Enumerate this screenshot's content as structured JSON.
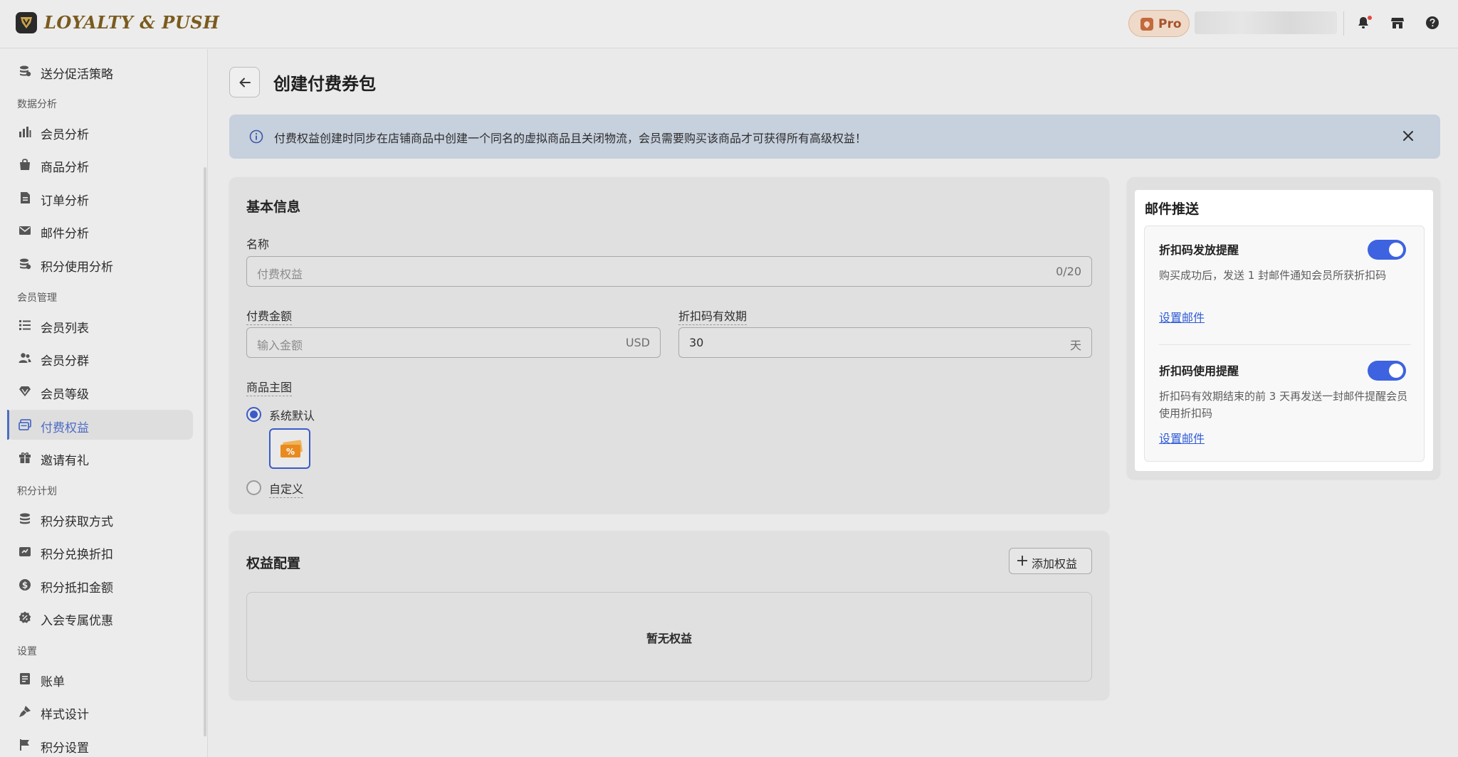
{
  "app": {
    "logo_text": "LOYALTY & PUSH",
    "plan_badge": "Pro"
  },
  "colors": {
    "accent": "#3D63E0",
    "brand": "#7A5B1E",
    "active_nav": "#4D6CC4",
    "banner_bg": "#C7D0DD",
    "pro_badge": "#A6542C"
  },
  "topbar": {
    "icons": [
      "bell-icon",
      "store-icon",
      "help-icon"
    ]
  },
  "sidebar": {
    "top_item": {
      "label": "送分促活策略",
      "icon": "coins-stack-icon"
    },
    "sections": [
      {
        "title": "数据分析",
        "items": [
          {
            "label": "会员分析",
            "icon": "bar-chart-icon"
          },
          {
            "label": "商品分析",
            "icon": "shopping-bag-icon"
          },
          {
            "label": "订单分析",
            "icon": "document-icon"
          },
          {
            "label": "邮件分析",
            "icon": "mail-icon"
          },
          {
            "label": "积分使用分析",
            "icon": "coins-stack-icon"
          }
        ]
      },
      {
        "title": "会员管理",
        "items": [
          {
            "label": "会员列表",
            "icon": "list-icon"
          },
          {
            "label": "会员分群",
            "icon": "users-icon"
          },
          {
            "label": "会员等级",
            "icon": "diamond-icon"
          },
          {
            "label": "付费权益",
            "icon": "ticket-icon",
            "active": true
          },
          {
            "label": "邀请有礼",
            "icon": "gift-icon"
          }
        ]
      },
      {
        "title": "积分计划",
        "items": [
          {
            "label": "积分获取方式",
            "icon": "coins-icon"
          },
          {
            "label": "积分兑换折扣",
            "icon": "discount-card-icon"
          },
          {
            "label": "积分抵扣金额",
            "icon": "dollar-circle-icon"
          },
          {
            "label": "入会专属优惠",
            "icon": "percent-badge-icon"
          }
        ]
      },
      {
        "title": "设置",
        "items": [
          {
            "label": "账单",
            "icon": "bill-icon"
          },
          {
            "label": "样式设计",
            "icon": "brush-icon"
          },
          {
            "label": "积分设置",
            "icon": "flag-icon"
          }
        ]
      }
    ]
  },
  "page": {
    "title": "创建付费券包"
  },
  "banner": {
    "text": "付费权益创建时同步在店铺商品中创建一个同名的虚拟商品且关闭物流，会员需要购买该商品才可获得所有高级权益！"
  },
  "basic_info": {
    "title": "基本信息",
    "name_label": "名称",
    "name_placeholder": "付费权益",
    "name_counter": "0/20",
    "amount_label": "付费金额",
    "amount_placeholder": "输入金额",
    "amount_currency": "USD",
    "validity_label": "折扣码有效期",
    "validity_value": "30",
    "validity_unit": "天",
    "image_label": "商品主图",
    "image_options": [
      {
        "label": "系统默认",
        "selected": true
      },
      {
        "label": "自定义",
        "selected": false
      }
    ]
  },
  "benefits": {
    "title": "权益配置",
    "add_button": "添加权益",
    "empty_text": "暂无权益"
  },
  "email_push": {
    "title": "邮件推送",
    "items": [
      {
        "title": "折扣码发放提醒",
        "enabled": true,
        "description": "购买成功后，发送 1 封邮件通知会员所获折扣码",
        "link": "设置邮件"
      },
      {
        "title": "折扣码使用提醒",
        "enabled": true,
        "description": "折扣码有效期结束的前 3 天再发送一封邮件提醒会员使用折扣码",
        "link": "设置邮件"
      }
    ]
  }
}
